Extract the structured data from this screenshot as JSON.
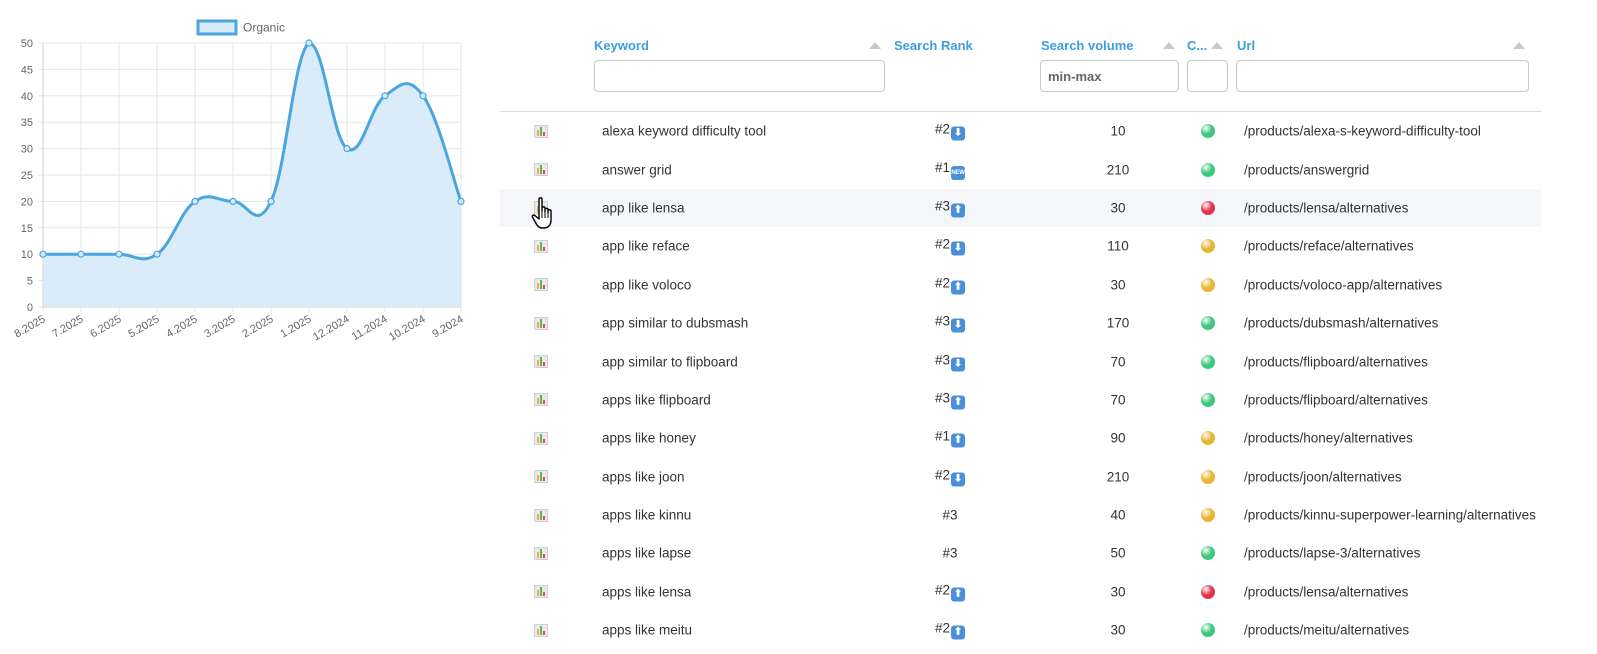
{
  "chart_data": {
    "type": "area",
    "x": [
      "8.2025",
      "7.2025",
      "6.2025",
      "5.2025",
      "4.2025",
      "3.2025",
      "2.2025",
      "1.2025",
      "12.2024",
      "11.2024",
      "10.2024",
      "9.2024"
    ],
    "series": [
      {
        "name": "Organic",
        "values": [
          10,
          10,
          10,
          10,
          20,
          20,
          20,
          50,
          30,
          40,
          40,
          20
        ]
      }
    ],
    "ylim": [
      0,
      50
    ],
    "yticks": [
      0,
      5,
      10,
      15,
      20,
      25,
      30,
      35,
      40,
      45,
      50
    ],
    "grid": true,
    "legend": "top-center",
    "colors": {
      "line": "#49a6e0",
      "fill": "#d6eafa"
    }
  },
  "table": {
    "headers": {
      "keyword": "Keyword",
      "rank": "Search Rank",
      "volume": "Search volume",
      "competition": "C...",
      "url": "Url"
    },
    "filters": {
      "keyword_placeholder": "",
      "volume_placeholder": "min-max",
      "competition_placeholder": "",
      "url_placeholder": ""
    },
    "rows": [
      {
        "keyword": "alexa keyword difficulty tool",
        "rank": "#2",
        "trend": "down",
        "volume": "10",
        "status": "green",
        "url": "/products/alexa-s-keyword-difficulty-tool"
      },
      {
        "keyword": "answer grid",
        "rank": "#1",
        "trend": "new",
        "volume": "210",
        "status": "green",
        "url": "/products/answergrid"
      },
      {
        "keyword": "app like lensa",
        "rank": "#3",
        "trend": "up",
        "volume": "30",
        "status": "red",
        "url": "/products/lensa/alternatives"
      },
      {
        "keyword": "app like reface",
        "rank": "#2",
        "trend": "down",
        "volume": "110",
        "status": "yellow",
        "url": "/products/reface/alternatives"
      },
      {
        "keyword": "app like voloco",
        "rank": "#2",
        "trend": "up",
        "volume": "30",
        "status": "yellow",
        "url": "/products/voloco-app/alternatives"
      },
      {
        "keyword": "app similar to dubsmash",
        "rank": "#3",
        "trend": "down",
        "volume": "170",
        "status": "green",
        "url": "/products/dubsmash/alternatives"
      },
      {
        "keyword": "app similar to flipboard",
        "rank": "#3",
        "trend": "down",
        "volume": "70",
        "status": "green",
        "url": "/products/flipboard/alternatives"
      },
      {
        "keyword": "apps like flipboard",
        "rank": "#3",
        "trend": "up",
        "volume": "70",
        "status": "green",
        "url": "/products/flipboard/alternatives"
      },
      {
        "keyword": "apps like honey",
        "rank": "#1",
        "trend": "up",
        "volume": "90",
        "status": "yellow",
        "url": "/products/honey/alternatives"
      },
      {
        "keyword": "apps like joon",
        "rank": "#2",
        "trend": "down",
        "volume": "210",
        "status": "yellow",
        "url": "/products/joon/alternatives"
      },
      {
        "keyword": "apps like kinnu",
        "rank": "#3",
        "trend": "none",
        "volume": "40",
        "status": "yellow",
        "url": "/products/kinnu-superpower-learning/alternatives"
      },
      {
        "keyword": "apps like lapse",
        "rank": "#3",
        "trend": "none",
        "volume": "50",
        "status": "green",
        "url": "/products/lapse-3/alternatives"
      },
      {
        "keyword": "apps like lensa",
        "rank": "#2",
        "trend": "up",
        "volume": "30",
        "status": "red",
        "url": "/products/lensa/alternatives"
      },
      {
        "keyword": "apps like meitu",
        "rank": "#2",
        "trend": "up",
        "volume": "30",
        "status": "green",
        "url": "/products/meitu/alternatives"
      }
    ],
    "hover_row": 2,
    "status_colors": {
      "green": "#3ec77a",
      "yellow": "#e8b534",
      "red": "#e0334d"
    },
    "badge_text": {
      "up": "⬆",
      "down": "⬇",
      "new": "NEW"
    },
    "icons": {
      "row_action": "bar-chart-icon",
      "cursor": "hand-pointer-icon"
    }
  }
}
